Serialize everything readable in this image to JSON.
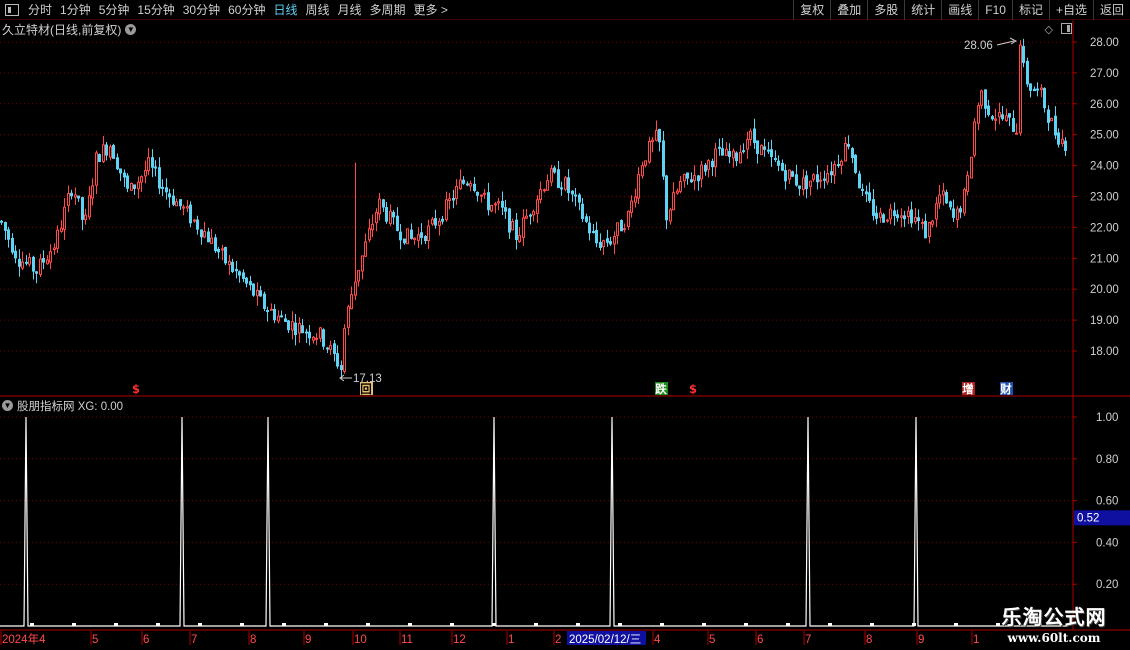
{
  "toolbar": {
    "periods": [
      "分时",
      "1分钟",
      "5分钟",
      "15分钟",
      "30分钟",
      "60分钟",
      "日线",
      "周线",
      "月线",
      "多周期",
      "更多 >"
    ],
    "active_period": "日线",
    "right_items": [
      "复权",
      "叠加",
      "多股",
      "统计",
      "画线",
      "F10",
      "标记",
      "+自选",
      "返回"
    ]
  },
  "chart": {
    "title": "久立特材(日线,前复权)",
    "price_axis": [
      "28.00",
      "27.00",
      "26.00",
      "25.00",
      "24.00",
      "23.00",
      "22.00",
      "21.00",
      "20.00",
      "19.00",
      "18.00"
    ],
    "high_label": "28.06",
    "low_label": "17.13",
    "markers": [
      {
        "text": "$",
        "color": "#ff3030",
        "bg": ""
      },
      {
        "text": "回",
        "color": "#000000",
        "bg": "#e8c070"
      },
      {
        "text": "跌",
        "color": "#ffffff",
        "bg": "#1c8a1c"
      },
      {
        "text": "$",
        "color": "#ff3030",
        "bg": ""
      },
      {
        "text": "增",
        "color": "#ffffff",
        "bg": "#b02020"
      },
      {
        "text": "财",
        "color": "#ffffff",
        "bg": "#2050b0"
      }
    ]
  },
  "indicator": {
    "title": "股朋指标网 XG: 0.00",
    "axis": [
      "1.00",
      "0.80",
      "0.60",
      "0.40",
      "0.20"
    ],
    "current_value": "0.52"
  },
  "date_axis": {
    "labels": [
      "2024年4",
      "5",
      "6",
      "7",
      "8",
      "9",
      "10",
      "11",
      "12",
      "1",
      "2",
      "3",
      "4",
      "5",
      "6",
      "7",
      "8",
      "9",
      "1"
    ],
    "highlight": "2025/02/12/三"
  },
  "watermark": {
    "title": "乐淘公式网",
    "url": "www.60lt.com"
  },
  "colors": {
    "up": "#ff4a4a",
    "down": "#5fd3f3",
    "grid": "#7a0000",
    "axis_text": "#d0d0d0",
    "tag_bg": "#1010a0"
  }
}
